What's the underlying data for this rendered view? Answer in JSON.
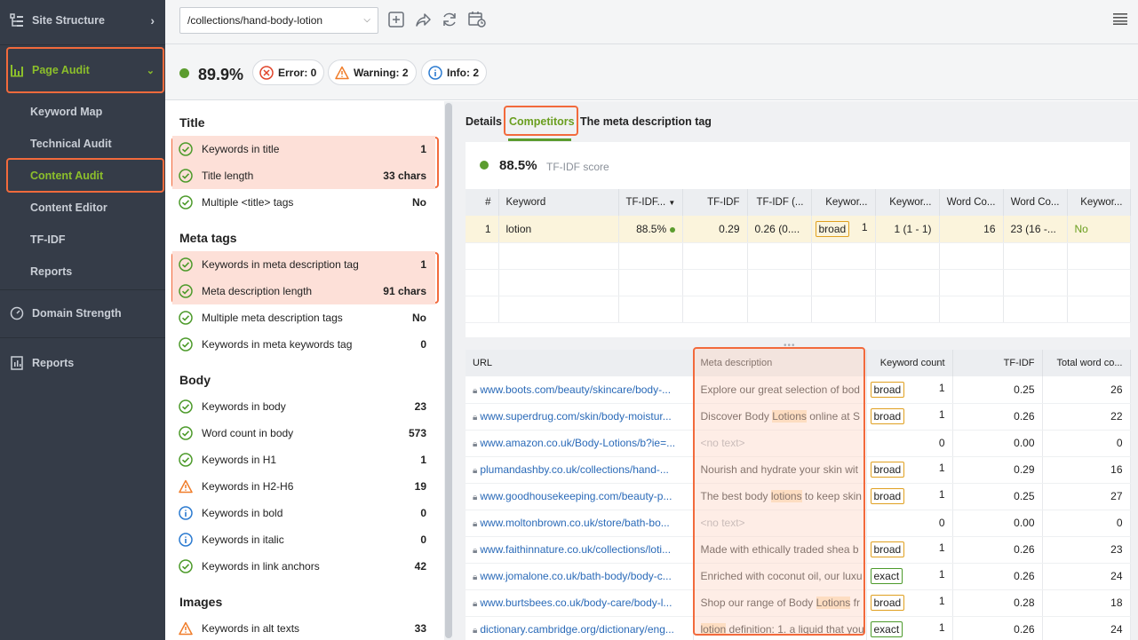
{
  "sidebar": {
    "site_structure": "Site Structure",
    "page_audit": "Page Audit",
    "sub_items": [
      "Keyword Map",
      "Technical Audit",
      "Content Audit",
      "Content Editor",
      "TF-IDF",
      "Reports"
    ],
    "domain_strength": "Domain Strength",
    "reports": "Reports"
  },
  "topbar": {
    "url": "/collections/hand-body-lotion"
  },
  "score": {
    "value": "89.9%",
    "error": "Error: 0",
    "warning": "Warning: 2",
    "info": "Info: 2"
  },
  "checklist": {
    "title_section": "Title",
    "title_rows": [
      {
        "label": "Keywords in title",
        "value": "1"
      },
      {
        "label": "Title length",
        "value": "33 chars"
      },
      {
        "label": "Multiple <title> tags",
        "value": "No"
      }
    ],
    "meta_section": "Meta tags",
    "meta_rows": [
      {
        "label": "Keywords in meta description tag",
        "value": "1"
      },
      {
        "label": "Meta description length",
        "value": "91 chars"
      },
      {
        "label": "Multiple meta description tags",
        "value": "No"
      },
      {
        "label": "Keywords in meta keywords tag",
        "value": "0"
      }
    ],
    "body_section": "Body",
    "body_rows": [
      {
        "label": "Keywords in body",
        "value": "23"
      },
      {
        "label": "Word count in body",
        "value": "573"
      },
      {
        "label": "Keywords in H1",
        "value": "1"
      },
      {
        "label": "Keywords in H2-H6",
        "value": "19"
      },
      {
        "label": "Keywords in bold",
        "value": "0"
      },
      {
        "label": "Keywords in italic",
        "value": "0"
      },
      {
        "label": "Keywords in link anchors",
        "value": "42"
      }
    ],
    "images_section": "Images",
    "images_rows": [
      {
        "label": "Keywords in alt texts",
        "value": "33"
      }
    ]
  },
  "tabs": {
    "details": "Details",
    "competitors": "Competitors",
    "meta": "The meta description tag"
  },
  "tfidf": {
    "score": "88.5%",
    "label": "TF-IDF score"
  },
  "kw_table": {
    "headers": [
      "#",
      "Keyword",
      "TF-IDF...",
      "TF-IDF",
      "TF-IDF (...",
      "Keywor...",
      "Keywor...",
      "Word Co...",
      "Word Co...",
      "Keywor..."
    ],
    "row": {
      "num": "1",
      "keyword": "lotion",
      "tfidf_score": "88.5%",
      "tfidf": "0.29",
      "tfidf_range": "0.26 (0....",
      "match": "broad",
      "kw_count": "1",
      "kw_range": "1 (1 - 1)",
      "word_count": "16",
      "word_range": "23 (16 -...",
      "kw_in": "No"
    }
  },
  "url_table": {
    "headers": [
      "URL",
      "Meta description",
      "Keyword count",
      "TF-IDF",
      "Total word co..."
    ],
    "rows": [
      {
        "url": "www.boots.com/beauty/skincare/body-...",
        "pre": "Explore our great selection of bod",
        "hi": "",
        "post": "",
        "match": "broad",
        "count": "1",
        "tfidf": "0.25",
        "total": "26"
      },
      {
        "url": "www.superdrug.com/skin/body-moistur...",
        "pre": "Discover Body ",
        "hi": "Lotions",
        "post": " online at S",
        "match": "broad",
        "count": "1",
        "tfidf": "0.26",
        "total": "22"
      },
      {
        "url": "www.amazon.co.uk/Body-Lotions/b?ie=...",
        "pre": "<no text>",
        "hi": "",
        "post": "",
        "match": "",
        "count": "0",
        "tfidf": "0.00",
        "total": "0"
      },
      {
        "url": "plumandashby.co.uk/collections/hand-...",
        "pre": "Nourish and hydrate your skin wit",
        "hi": "",
        "post": "",
        "match": "broad",
        "count": "1",
        "tfidf": "0.29",
        "total": "16"
      },
      {
        "url": "www.goodhousekeeping.com/beauty-p...",
        "pre": "The best body ",
        "hi": "lotions",
        "post": " to keep skin",
        "match": "broad",
        "count": "1",
        "tfidf": "0.25",
        "total": "27"
      },
      {
        "url": "www.moltonbrown.co.uk/store/bath-bo...",
        "pre": "<no text>",
        "hi": "",
        "post": "",
        "match": "",
        "count": "0",
        "tfidf": "0.00",
        "total": "0"
      },
      {
        "url": "www.faithinnature.co.uk/collections/loti...",
        "pre": "Made with ethically traded shea b",
        "hi": "",
        "post": "",
        "match": "broad",
        "count": "1",
        "tfidf": "0.26",
        "total": "23"
      },
      {
        "url": "www.jomalone.co.uk/bath-body/body-c...",
        "pre": "Enriched with coconut oil, our luxu",
        "hi": "",
        "post": "",
        "match": "exact",
        "count": "1",
        "tfidf": "0.26",
        "total": "24"
      },
      {
        "url": "www.burtsbees.co.uk/body-care/body-l...",
        "pre": "Shop our range of Body ",
        "hi": "Lotions",
        "post": " fr",
        "match": "broad",
        "count": "1",
        "tfidf": "0.28",
        "total": "18"
      },
      {
        "url": "dictionary.cambridge.org/dictionary/eng...",
        "pre": "",
        "hi": "lotion",
        "post": " definition: 1. a liquid that you",
        "match": "exact",
        "count": "1",
        "tfidf": "0.26",
        "total": "24"
      }
    ]
  },
  "colors": {
    "accent": "#8cbf2b",
    "highlight_border": "#f26a3c",
    "score_green": "#5b9c2e",
    "sidebar_bg": "#353c48"
  }
}
